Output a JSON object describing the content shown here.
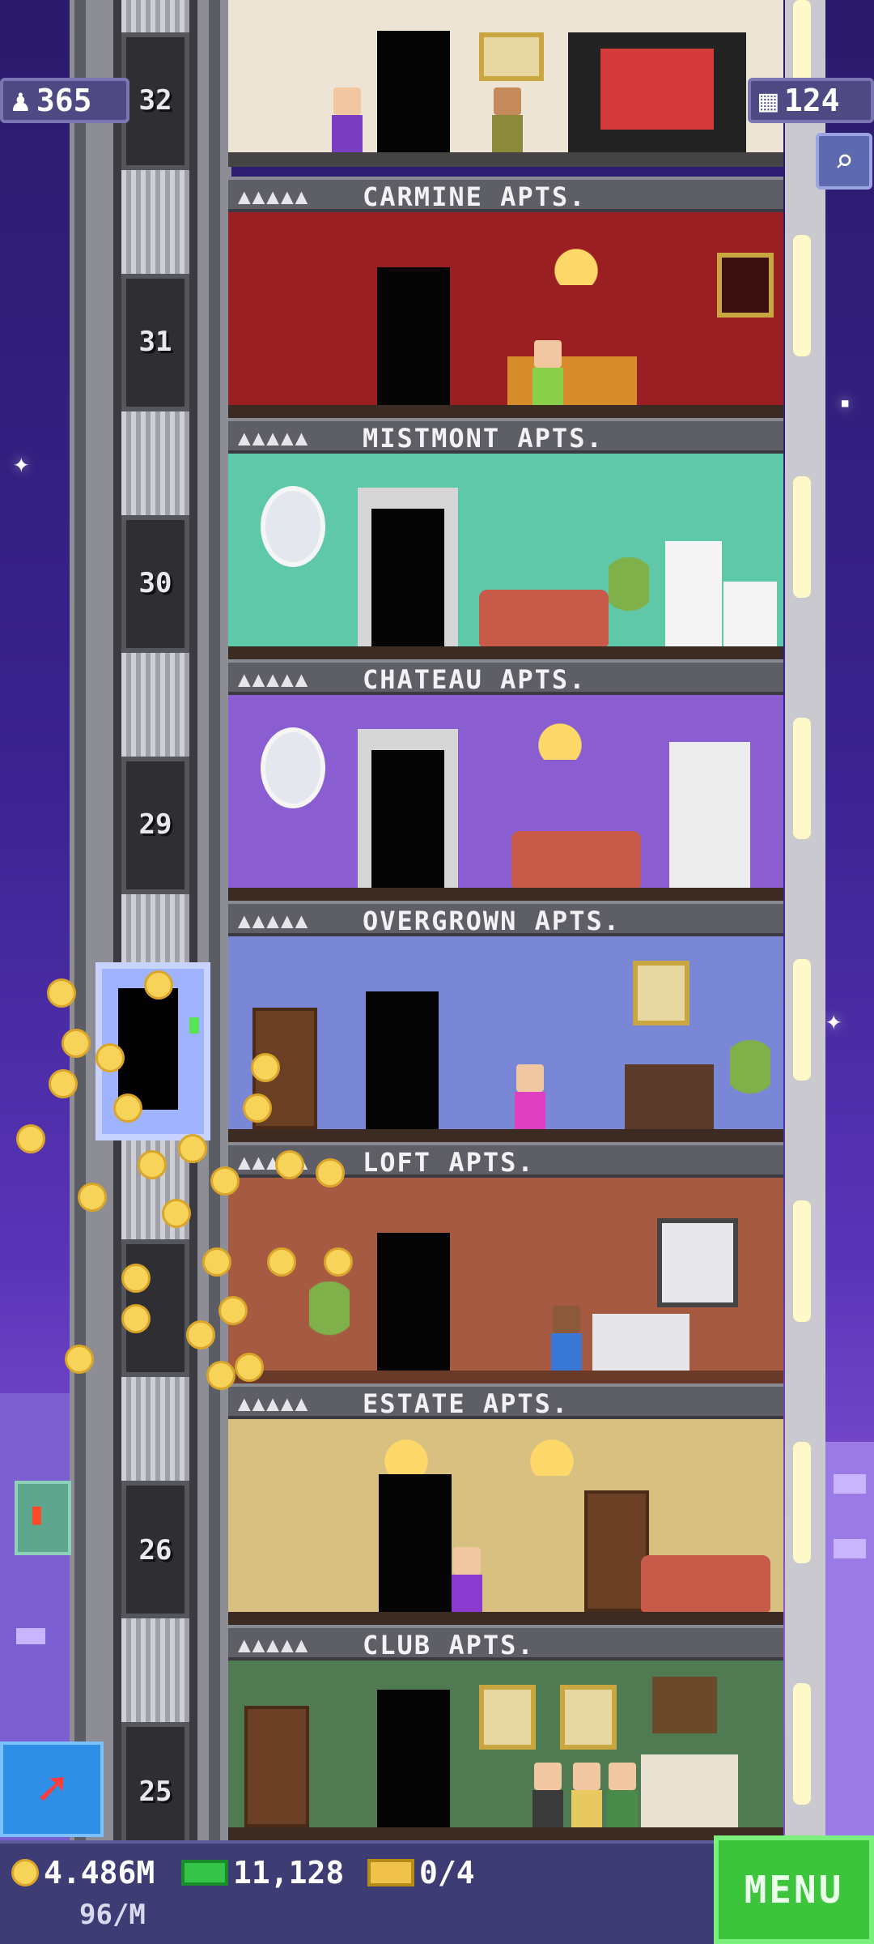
{
  "hud": {
    "population": "365",
    "floors": "124"
  },
  "floor_numbers": [
    "32",
    "31",
    "30",
    "29",
    "26",
    "25"
  ],
  "floors": [
    {
      "name": "CARMINE APTS.",
      "people": "▲▲▲▲▲"
    },
    {
      "name": "MISTMONT APTS.",
      "people": "▲▲▲▲▲"
    },
    {
      "name": "CHATEAU APTS.",
      "people": "▲▲▲▲▲"
    },
    {
      "name": "OVERGROWN APTS.",
      "people": "▲▲▲▲▲"
    },
    {
      "name": "LOFT APTS.",
      "people": "▲▲▲▲▲"
    },
    {
      "name": "ESTATE APTS.",
      "people": "▲▲▲▲▲"
    },
    {
      "name": "CLUB APTS.",
      "people": "▲▲▲▲▲"
    }
  ],
  "bottom_bar": {
    "coins": "4.486M",
    "rate": "96/M",
    "bux": "11,128",
    "tickets": "0/4",
    "menu_label": "MENU"
  },
  "icons": {
    "population": "person-icon",
    "floors": "building-icon",
    "search": "magnifier-icon",
    "coins": "coin-icon",
    "bux": "bux-icon",
    "tickets": "golden-ticket-icon",
    "bitizen": "arrow-icon",
    "fries": "fries-icon"
  },
  "colors": {
    "sky": "#3a2390",
    "menu": "#3cc43c",
    "bottom_bar": "#3d3c74"
  }
}
